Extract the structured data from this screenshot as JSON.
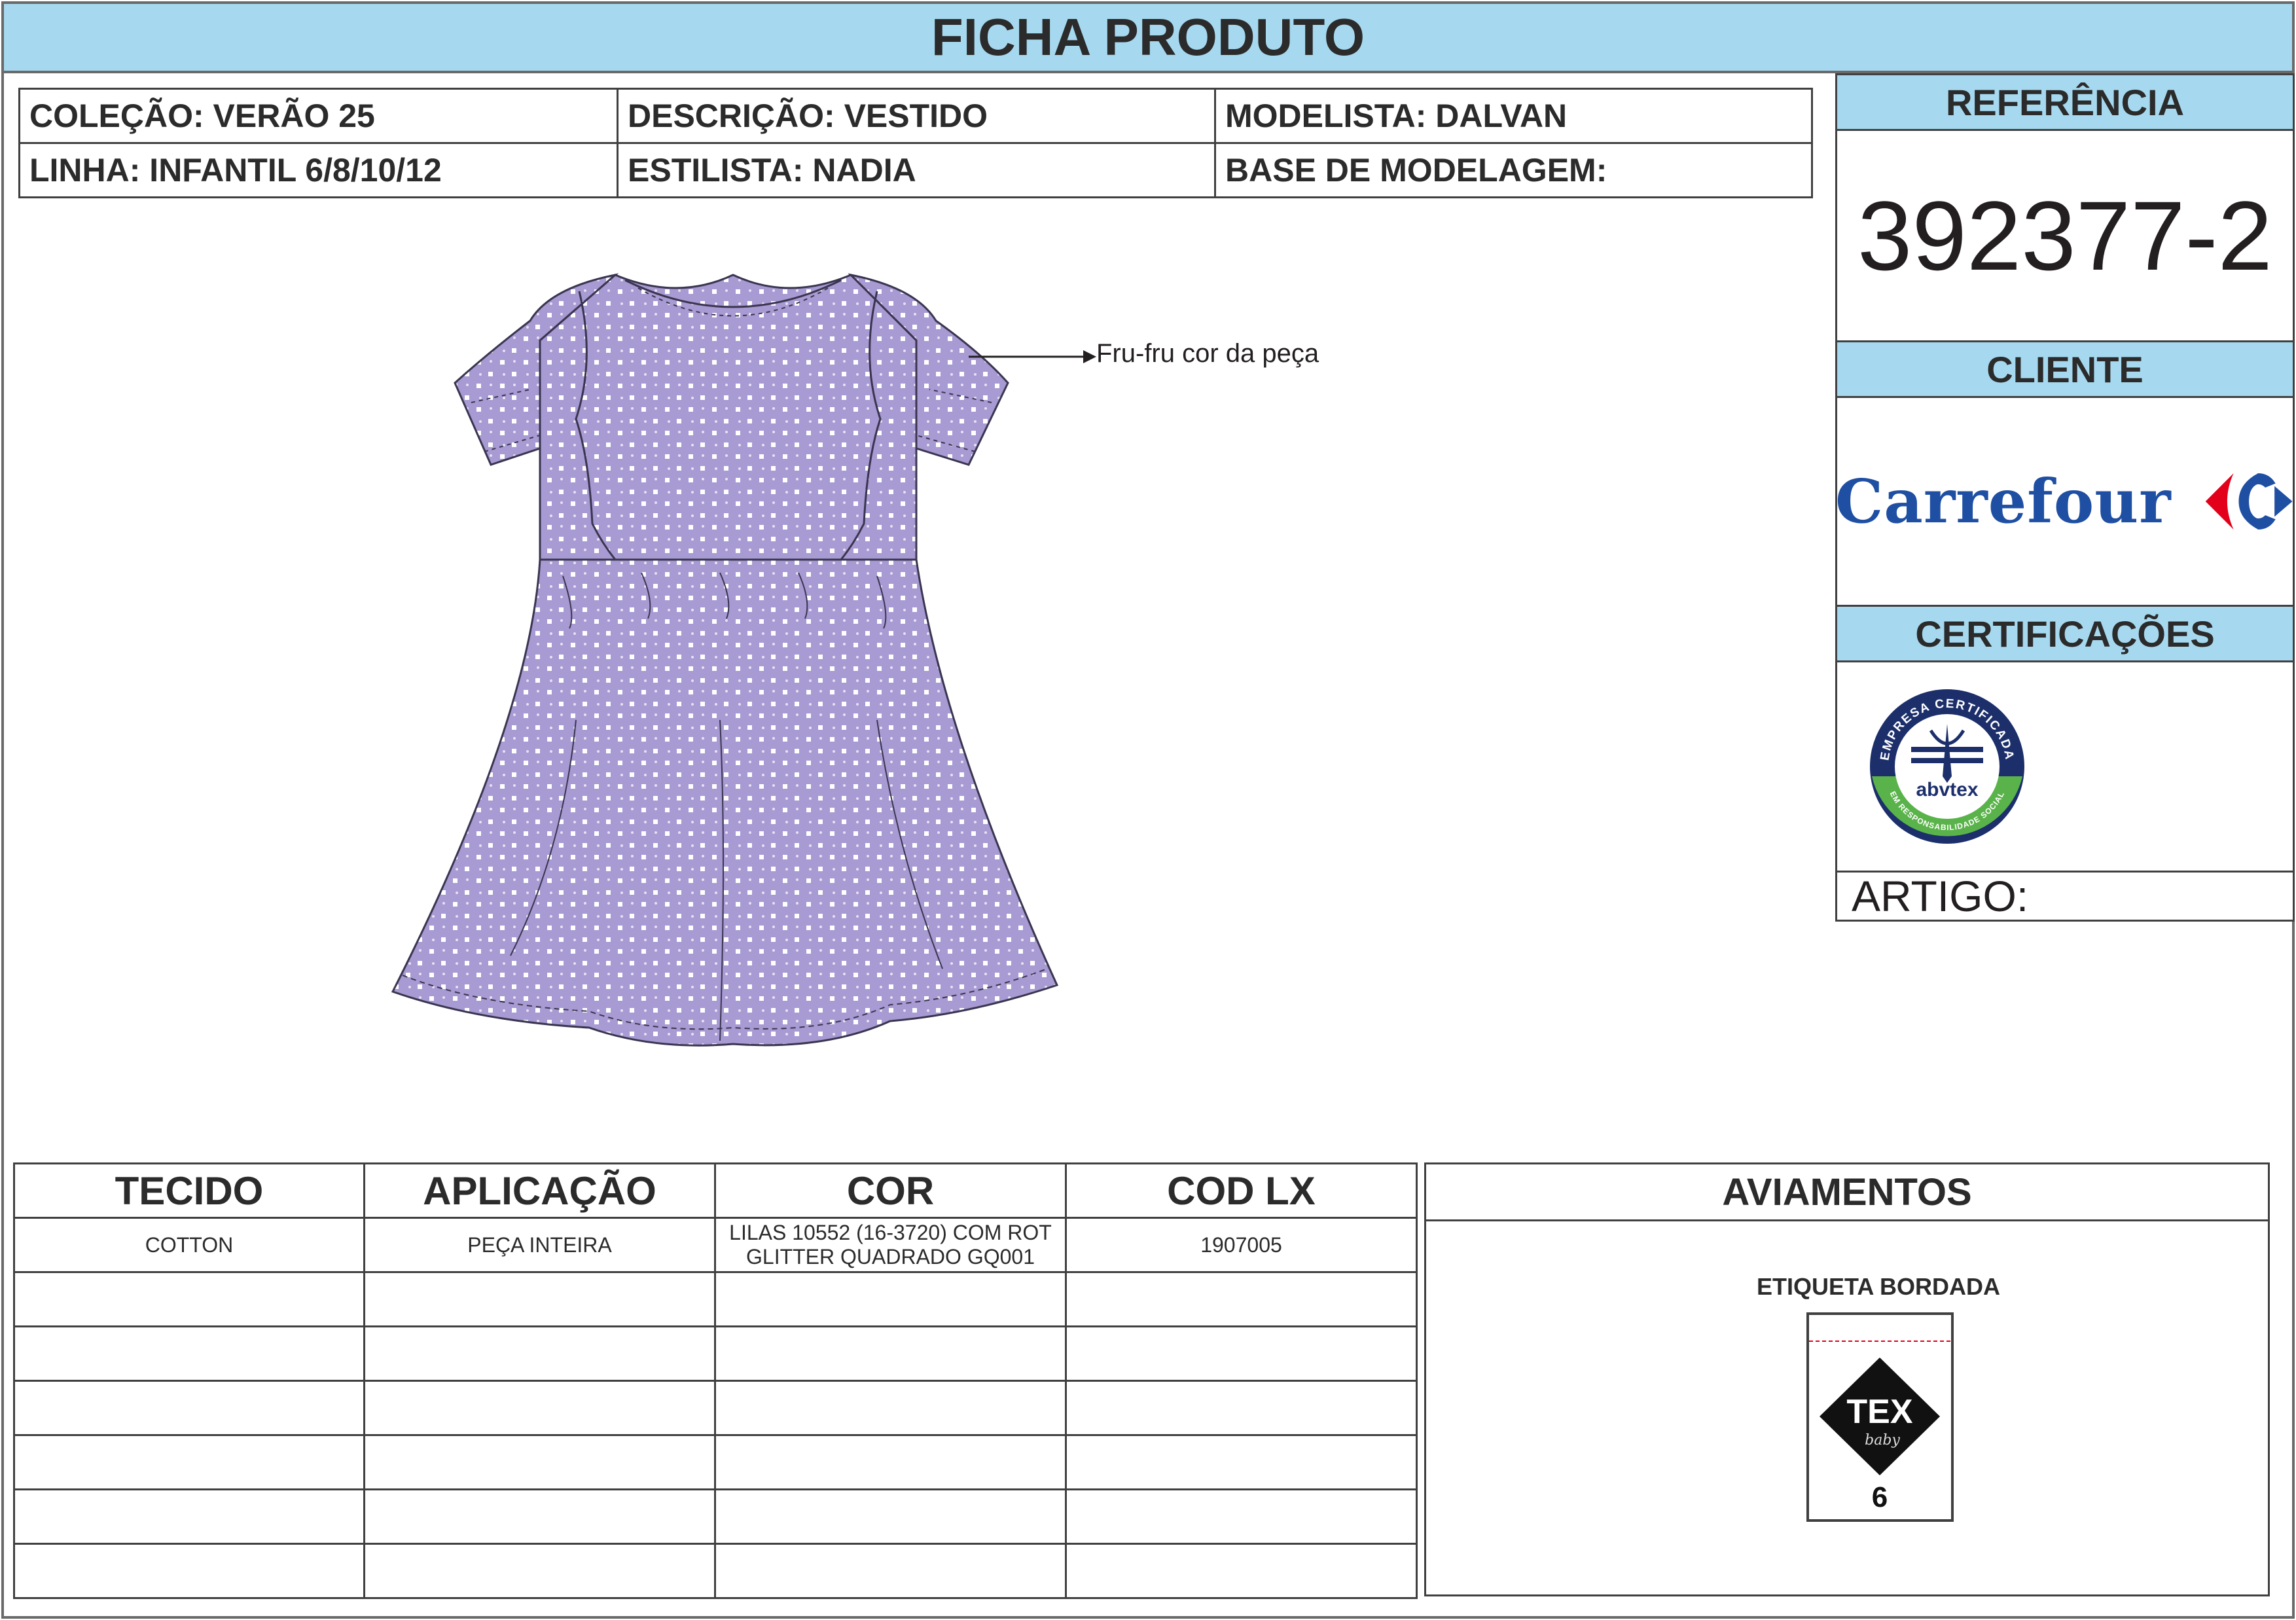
{
  "header": {
    "title": "FICHA PRODUTO"
  },
  "info": {
    "colecao": "COLEÇÃO: VERÃO 25",
    "descricao": "DESCRIÇÃO: VESTIDO",
    "modelista": "MODELISTA: DALVAN",
    "linha": "LINHA: INFANTIL 6/8/10/12",
    "estilista": "ESTILISTA: NADIA",
    "base": "BASE DE MODELAGEM:"
  },
  "sidebar": {
    "referencia_label": "REFERÊNCIA",
    "referencia_value": "392377-2",
    "cliente_label": "CLIENTE",
    "cliente_logo_text": "Carrefour",
    "certificacoes_label": "CERTIFICAÇÕES",
    "cert_logo_top": "EMPRESA CERTIFICADA",
    "cert_logo_brand": "abvtex",
    "cert_logo_bottom": "EM RESPONSABILIDADE SOCIAL",
    "artigo_label": "ARTIGO:"
  },
  "sketch": {
    "annotation": "Fru-fru cor da peça",
    "colors": {
      "fabric": "#a89ad2",
      "dots": "#ffffff",
      "outline": "#3a3550"
    }
  },
  "materials": {
    "headers": [
      "TECIDO",
      "APLICAÇÃO",
      "COR",
      "COD LX"
    ],
    "rows": [
      [
        "COTTON",
        "PEÇA INTEIRA",
        "LILAS 10552 (16-3720) COM ROT GLITTER QUADRADO GQ001",
        "1907005"
      ]
    ]
  },
  "aviamentos": {
    "title": "AVIAMENTOS",
    "item_label": "ETIQUETA BORDADA",
    "label_brand": "TEX",
    "label_sub": "baby",
    "label_size": "6"
  },
  "colors": {
    "header_bg": "#a6d9ef",
    "carrefour_blue": "#1f4fa3",
    "carrefour_red": "#e3001b",
    "abvtex_navy": "#1c2f6b",
    "abvtex_green": "#5ab34a"
  }
}
